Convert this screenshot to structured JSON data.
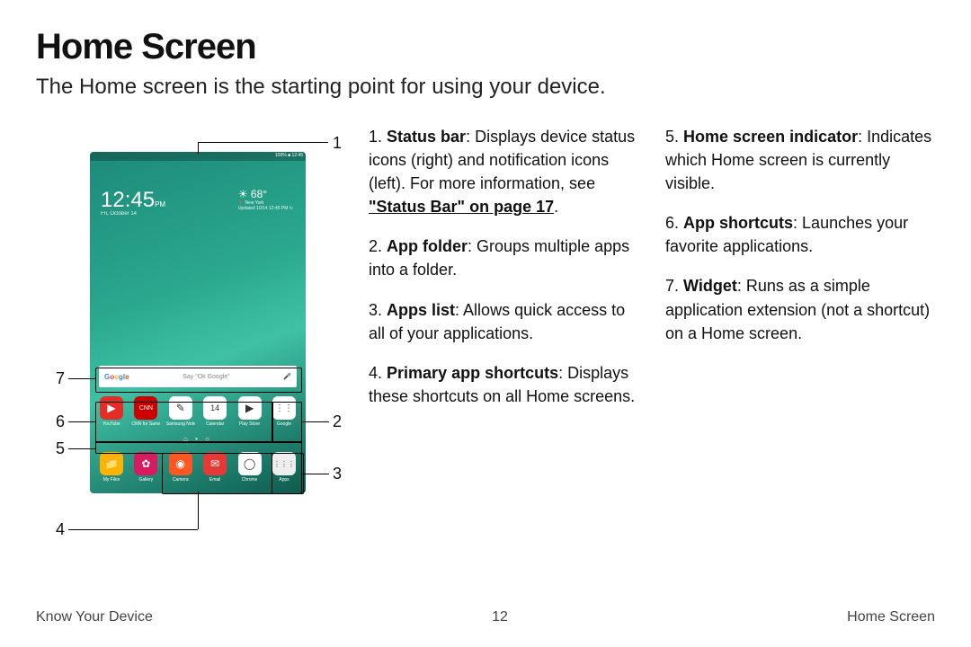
{
  "title": "Home Screen",
  "subtitle": "The Home screen is the starting point for using your device.",
  "footer": {
    "left": "Know Your Device",
    "center": "12",
    "right": "Home Screen"
  },
  "callouts": {
    "n1": "1",
    "n2": "2",
    "n3": "3",
    "n4": "4",
    "n5": "5",
    "n6": "6",
    "n7": "7"
  },
  "items": {
    "i1": {
      "num": "1.",
      "term": "Status bar",
      "rest": ": Displays device status icons (right) and notification icons (left). For more information, see ",
      "link": "\"Status Bar\" on page 17",
      "tail": "."
    },
    "i2": {
      "num": "2.",
      "term": "App folder",
      "rest": ": Groups multiple apps into a folder."
    },
    "i3": {
      "num": "3.",
      "term": "Apps list",
      "rest": ": Allows quick access to all of your applications."
    },
    "i4": {
      "num": "4.",
      "term": "Primary app shortcuts",
      "rest": ": Displays these shortcuts on all Home screens."
    },
    "i5": {
      "num": "5.",
      "term": "Home screen indicator",
      "rest": ": Indicates which Home screen is currently visible."
    },
    "i6": {
      "num": "6.",
      "term": "App shortcuts",
      "rest": ": Launches your favorite applications."
    },
    "i7": {
      "num": "7.",
      "term": "Widget",
      "rest": ": Runs as a simple application extension (not a shortcut) on a Home screen."
    }
  },
  "device": {
    "status_right": "100% ■ 12:45",
    "clock_time": "12:45",
    "clock_ampm": "PM",
    "clock_date": "Fri, October 14",
    "weather_temp": "68°",
    "weather_city": "New York",
    "weather_updated": "Updated 10/14 12:45 PM ↻",
    "search_hint": "Say \"Ok Google\"",
    "pager": "⌂ • ○",
    "row6": [
      {
        "label": "YouTube",
        "color": "#e52d27",
        "glyph": "▶"
      },
      {
        "label": "CNN for Samsung",
        "color": "#cc0000",
        "glyph": "CNN",
        "fs": "7"
      },
      {
        "label": "Samsung Notes",
        "color": "#ffffff",
        "glyph": "✎"
      },
      {
        "label": "Calendar",
        "color": "#ffffff",
        "glyph": "14",
        "fs": "9"
      },
      {
        "label": "Play Store",
        "color": "#ffffff",
        "glyph": "▶"
      },
      {
        "label": "Google",
        "color": "#ffffff",
        "glyph": "⋮⋮",
        "fs": "10"
      }
    ],
    "row4": [
      {
        "label": "My Files",
        "color": "#ffb300",
        "glyph": "📁"
      },
      {
        "label": "Gallery",
        "color": "#d81b60",
        "glyph": "✿"
      },
      {
        "label": "Camera",
        "color": "#ff5722",
        "glyph": "◉"
      },
      {
        "label": "Email",
        "color": "#e53935",
        "glyph": "✉"
      },
      {
        "label": "Chrome",
        "color": "#ffffff",
        "glyph": "◯"
      },
      {
        "label": "Apps",
        "color": "#eeeeee",
        "glyph": "⋮⋮⋮",
        "fs": "8"
      }
    ]
  }
}
